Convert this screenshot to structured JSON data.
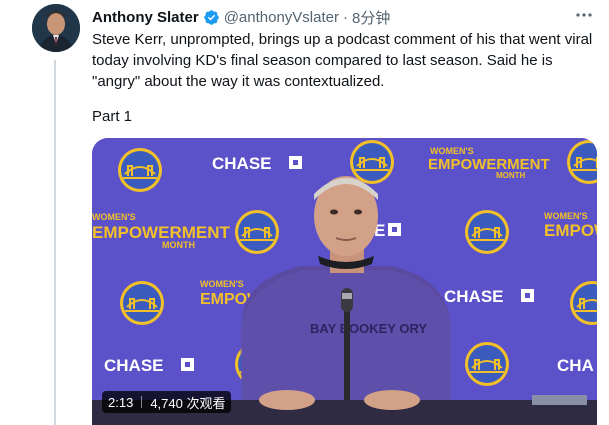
{
  "tweet": {
    "author_name": "Anthony Slater",
    "handle": "@anthonyVslater",
    "separator": "·",
    "time": "8分钟",
    "text": "Steve Kerr, unprompted, brings up a podcast comment of his that went viral today involving KD's final season compared to last season. Said he is \"angry\" about the way it was contextualized.",
    "part_label": "Part 1"
  },
  "video": {
    "duration": "2:13",
    "views": "4,740 次观看",
    "backdrop_logos": {
      "chase": "CHASE",
      "womens": "WOMEN'S",
      "empowerment": "EMPOWERMENT",
      "month": "MONTH"
    },
    "shirt_text": "BAY BOOKEY ORY"
  },
  "colors": {
    "backdrop": "#5b52c9",
    "gold": "#f2c028",
    "verified": "#1d9bf0",
    "muted": "#536471"
  }
}
